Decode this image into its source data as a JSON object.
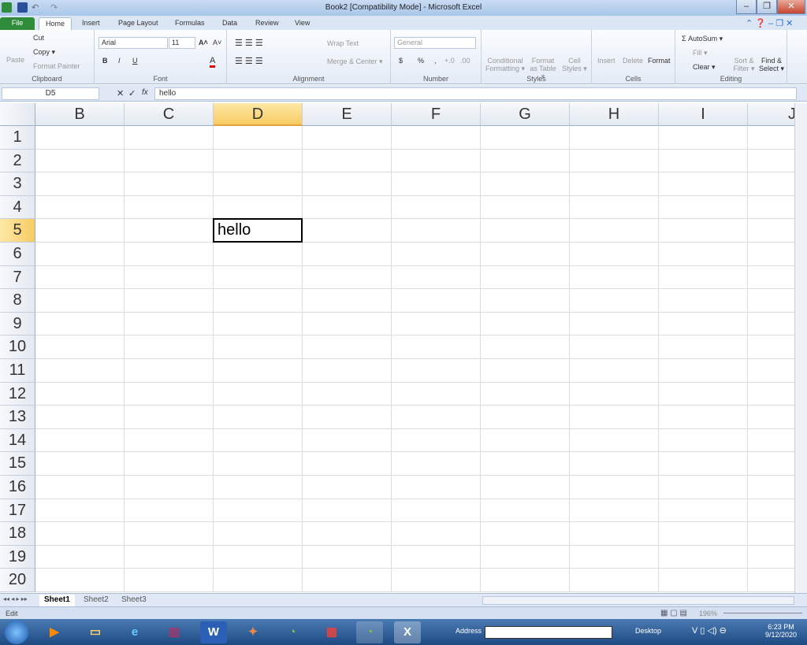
{
  "window": {
    "title": "Book2  [Compatibility Mode]  -  Microsoft Excel",
    "minimize": "–",
    "restore": "❐",
    "close": "✕"
  },
  "tabs": [
    "File",
    "Home",
    "Insert",
    "Page Layout",
    "Formulas",
    "Data",
    "Review",
    "View"
  ],
  "ribbon": {
    "clipboard": {
      "label": "Clipboard",
      "paste": "Paste",
      "cut": "Cut",
      "copy": "Copy ▾",
      "format_painter": "Format Painter"
    },
    "font": {
      "label": "Font",
      "name": "Arial",
      "size": "11",
      "bold": "B",
      "italic": "I",
      "underline": "U",
      "grow": "A˄",
      "shrink": "A˅",
      "color": "A"
    },
    "alignment": {
      "label": "Alignment",
      "wrap": "Wrap Text",
      "merge": "Merge & Center ▾"
    },
    "number": {
      "label": "Number",
      "format": "General",
      "currency": "$",
      "percent": "%",
      "comma": ",",
      "inc": "+.0",
      "dec": ".00"
    },
    "styles": {
      "label": "Styles",
      "conditional": "Conditional Formatting ▾",
      "table": "Format as Table ▾",
      "cell": "Cell Styles ▾"
    },
    "cells": {
      "label": "Cells",
      "insert": "Insert",
      "delete": "Delete",
      "format": "Format"
    },
    "editing": {
      "label": "Editing",
      "autosum": "Σ AutoSum ▾",
      "fill": "Fill ▾",
      "clear": "Clear ▾",
      "sort": "Sort & Filter ▾",
      "find": "Find & Select ▾"
    }
  },
  "formula_bar": {
    "name_box": "D5",
    "cancel": "✕",
    "enter": "✓",
    "fx": "fx",
    "value": "hello"
  },
  "grid": {
    "columns": [
      "B",
      "C",
      "D",
      "E",
      "F",
      "G",
      "H",
      "I",
      "J"
    ],
    "rows": [
      "1",
      "2",
      "3",
      "4",
      "5",
      "6",
      "7",
      "8",
      "9",
      "10",
      "11",
      "12",
      "13",
      "14",
      "15",
      "16",
      "17",
      "18",
      "19",
      "20"
    ],
    "active": {
      "col": "D",
      "row": "5",
      "value": "hello"
    }
  },
  "sheets": [
    "Sheet1",
    "Sheet2",
    "Sheet3"
  ],
  "status": {
    "mode": "Edit",
    "zoom": "196%"
  },
  "taskbar": {
    "address_label": "Address",
    "desktop": "Desktop",
    "time": "6:23 PM",
    "date": "9/12/2020"
  }
}
